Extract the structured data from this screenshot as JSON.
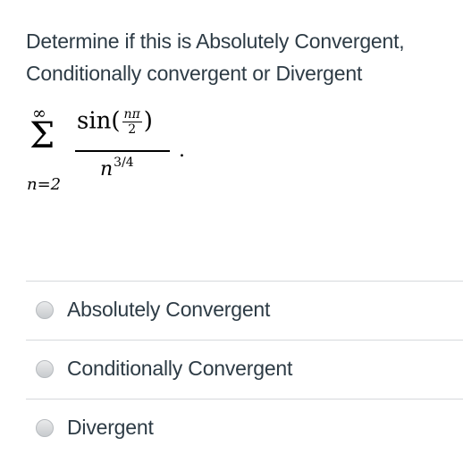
{
  "question": {
    "line1": "Determine if this is Absolutely Convergent,",
    "line2": "Conditionally convergent or Divergent"
  },
  "formula": {
    "sum_upper": "∞",
    "sum_symbol": "Σ",
    "sum_lower": "n=2",
    "numerator_func": "sin(",
    "numerator_inner_top": "nπ",
    "numerator_inner_bottom": "2",
    "numerator_close": ")",
    "denominator_base": "n",
    "denominator_exp": "3/4",
    "trailing": "."
  },
  "options": [
    {
      "label": "Absolutely Convergent"
    },
    {
      "label": "Conditionally Convergent"
    },
    {
      "label": "Divergent"
    }
  ]
}
